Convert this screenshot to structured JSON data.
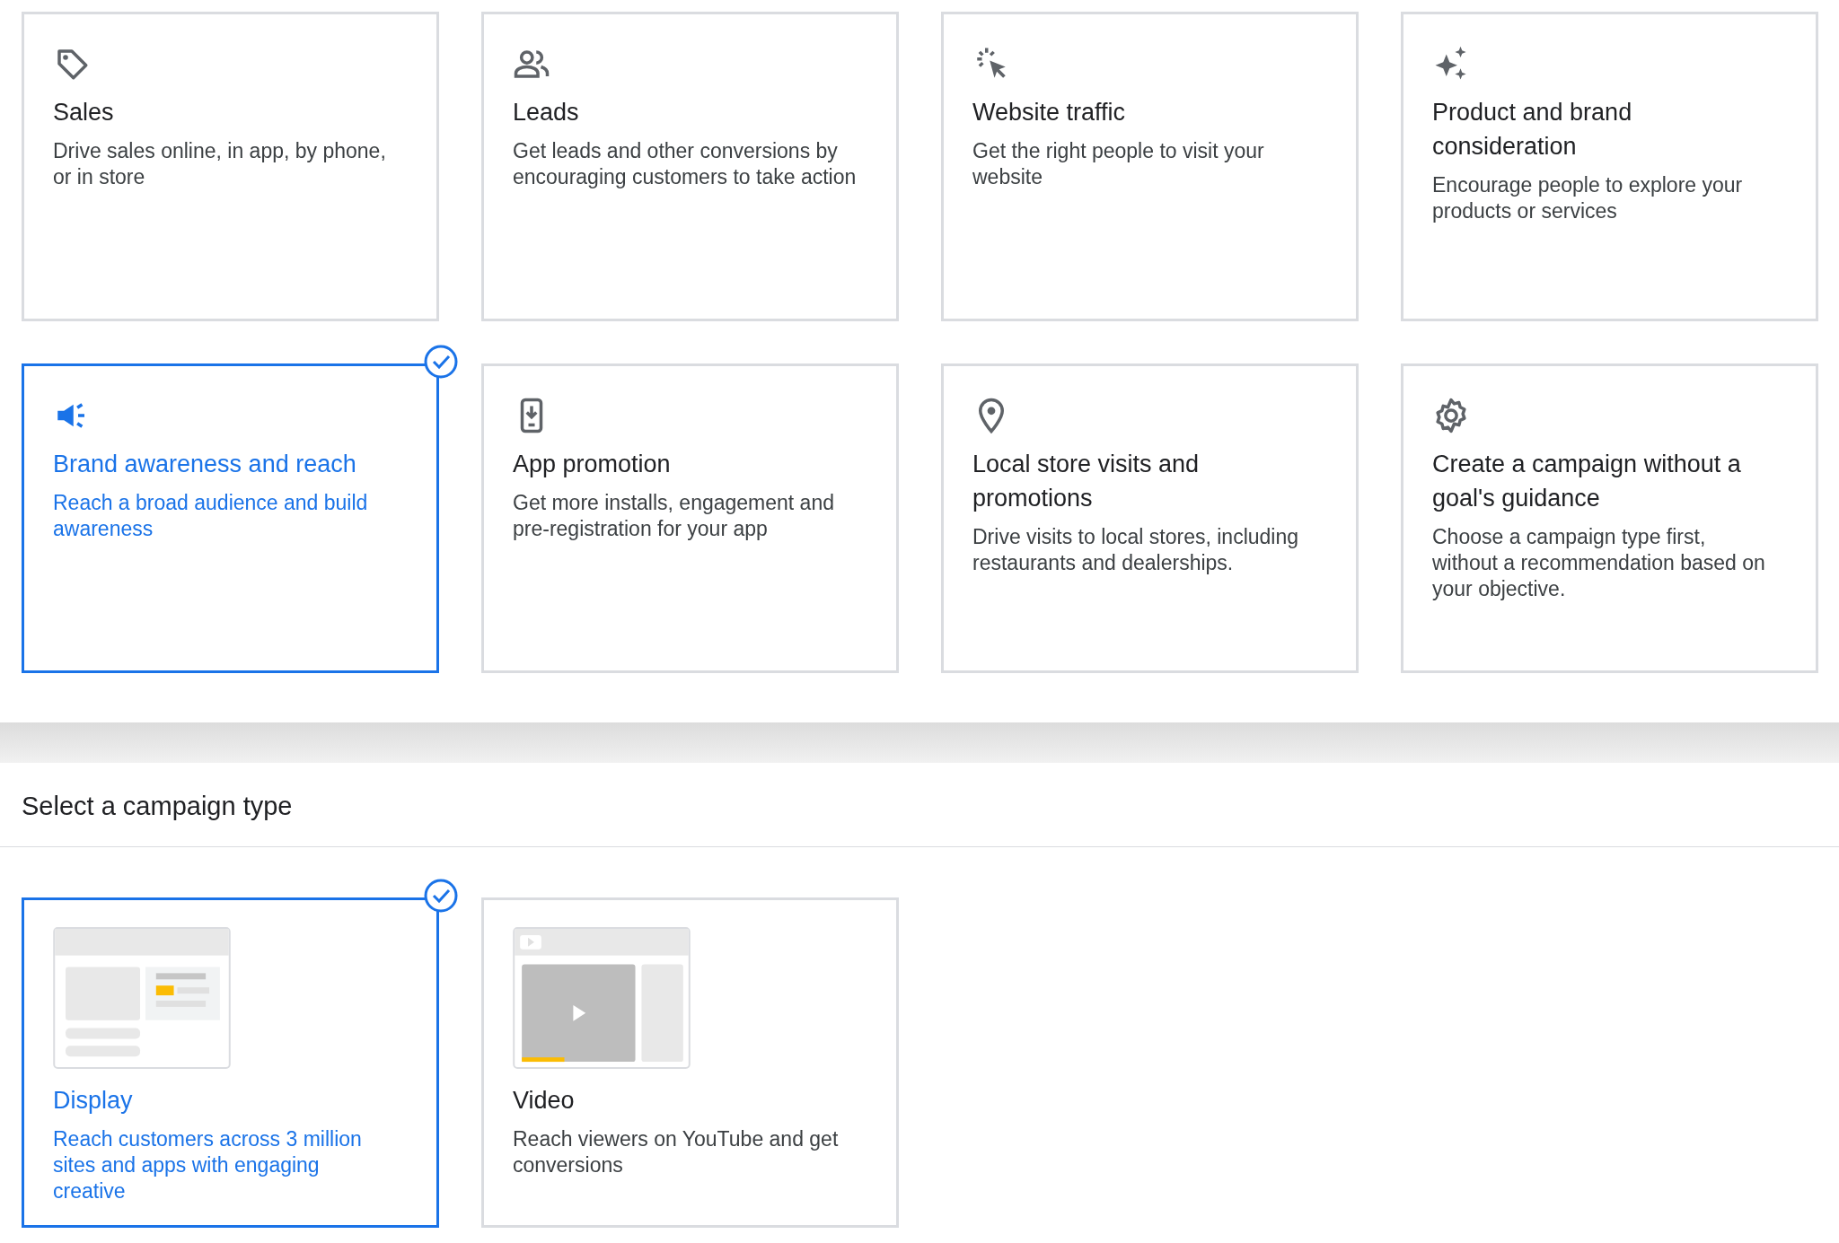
{
  "goals": [
    {
      "kind": "tag",
      "title": "Sales",
      "description": "Drive sales online, in app, by phone, or in store",
      "selected": false
    },
    {
      "kind": "people",
      "title": "Leads",
      "description": "Get leads and other conversions by encouraging customers to take action",
      "selected": false
    },
    {
      "kind": "click",
      "title": "Website traffic",
      "description": "Get the right people to visit your website",
      "selected": false
    },
    {
      "kind": "sparkle",
      "title": "Product and brand consideration",
      "description": "Encourage people to explore your products or services",
      "selected": false
    },
    {
      "kind": "megaphone",
      "title": "Brand awareness and reach",
      "description": "Reach a broad audience and build awareness",
      "selected": true
    },
    {
      "kind": "phone",
      "title": "App promotion",
      "description": "Get more installs, engagement and pre-registration for your app",
      "selected": false
    },
    {
      "kind": "pin",
      "title": "Local store visits and promotions",
      "description": "Drive visits to local stores, including restaurants and dealerships.",
      "selected": false
    },
    {
      "kind": "gear",
      "title": "Create a campaign without a goal's guidance",
      "description": "Choose a campaign type first, without a recommendation based on your objective.",
      "selected": false
    }
  ],
  "campaign_type_section": {
    "heading": "Select a campaign type",
    "types": [
      {
        "kind": "display",
        "title": "Display",
        "description": "Reach customers across 3 million sites and apps with engaging creative",
        "selected": true
      },
      {
        "kind": "video",
        "title": "Video",
        "description": "Reach viewers on YouTube and get conversions",
        "selected": false
      }
    ]
  }
}
